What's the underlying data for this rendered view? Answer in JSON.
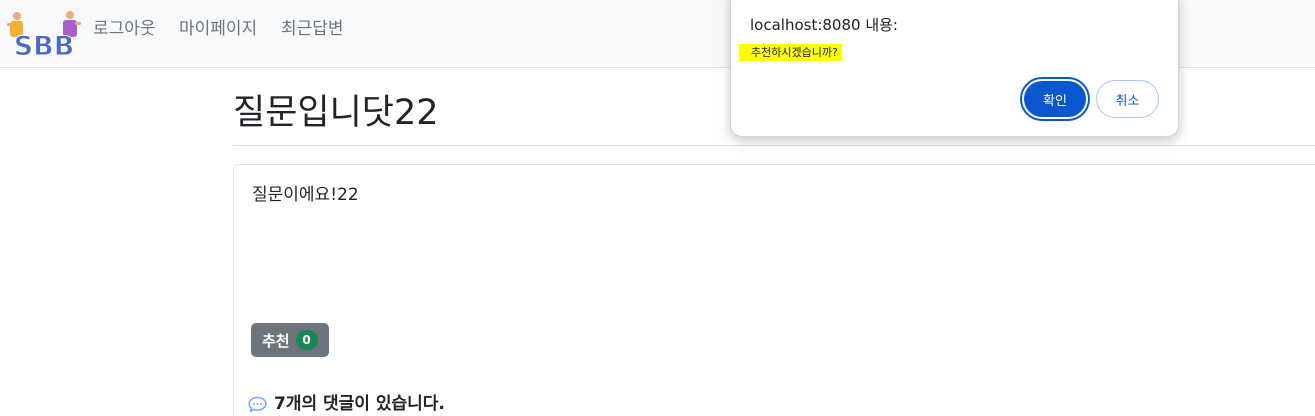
{
  "navbar": {
    "logo_text": "SBB",
    "links": {
      "logout": "로그아웃",
      "mypage": "마이페이지",
      "recent_answers": "최근답변"
    }
  },
  "question": {
    "subject": "질문입니닷22",
    "content": "질문이에요!22",
    "recommend_label": "추천",
    "recommend_count": "0"
  },
  "answers": {
    "count_text": "7개의 댓글이 있습니다.",
    "icon": "comment-icon"
  },
  "dialog": {
    "origin": "localhost:8080 내용:",
    "message": "추천하시겠습니까?",
    "ok_label": "확인",
    "cancel_label": "취소"
  },
  "colors": {
    "navbar_bg": "#f8f9fa",
    "logo_blue": "#4a67c8",
    "secondary": "#6c757d",
    "badge_green": "#198754",
    "dialog_primary": "#0b57d0",
    "highlight": "#ffff00"
  }
}
